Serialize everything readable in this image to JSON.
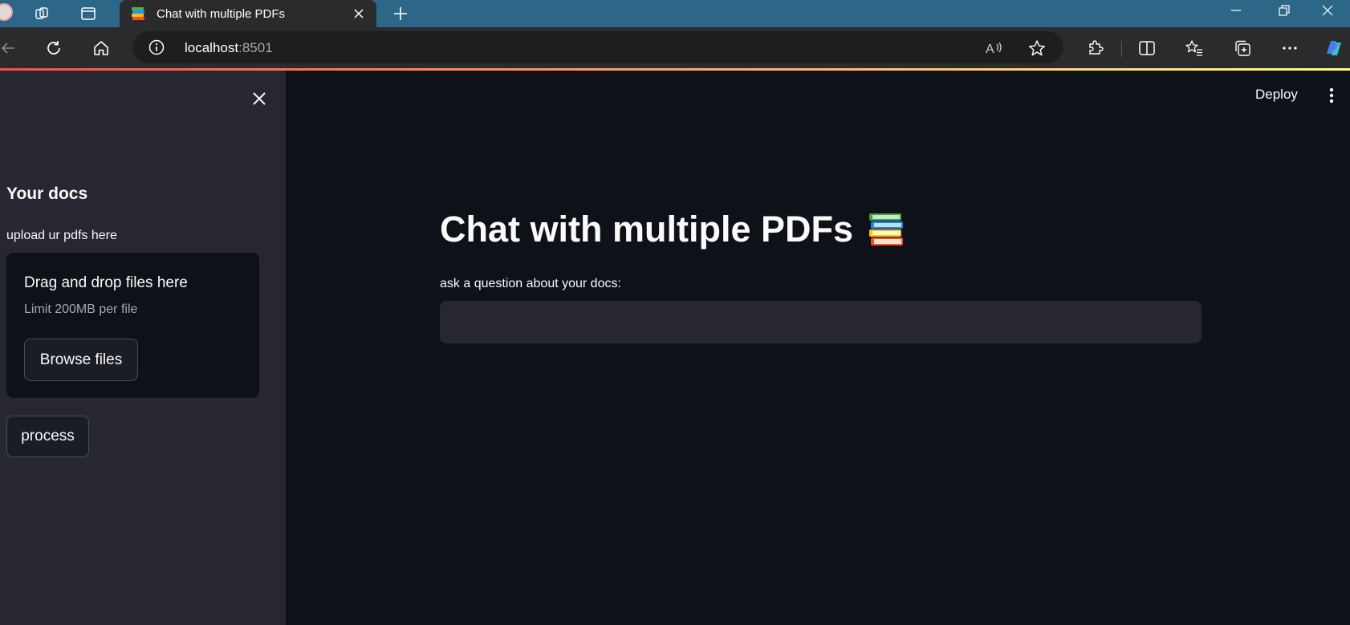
{
  "browser": {
    "tab_title": "Chat with multiple PDFs",
    "url_host": "localhost",
    "url_port": ":8501",
    "tab_icons": [
      "workspaces-icon",
      "tab-actions-icon"
    ],
    "toolbar_icons": [
      "read-aloud-icon",
      "favorite-star-icon",
      "extensions-icon",
      "split-screen-icon",
      "favorites-icon",
      "collections-icon",
      "more-icon",
      "copilot-icon"
    ]
  },
  "sidebar": {
    "title": "Your docs",
    "uploader_label": "upload ur pdfs here",
    "dropzone_title": "Drag and drop files here",
    "dropzone_limit": "Limit 200MB per file",
    "browse_label": "Browse files",
    "process_label": "process"
  },
  "header": {
    "deploy_label": "Deploy"
  },
  "main": {
    "title": "Chat with multiple PDFs",
    "title_emoji": "books-icon",
    "question_label": "ask a question about your docs:",
    "question_value": ""
  },
  "colors": {
    "app_bg": "#0e1117",
    "sidebar_bg": "#262730",
    "text": "#fafafa",
    "accent_red": "#ff4b4b",
    "accent_yellow": "#fffd80",
    "browser_tabbar": "#2c6788"
  }
}
